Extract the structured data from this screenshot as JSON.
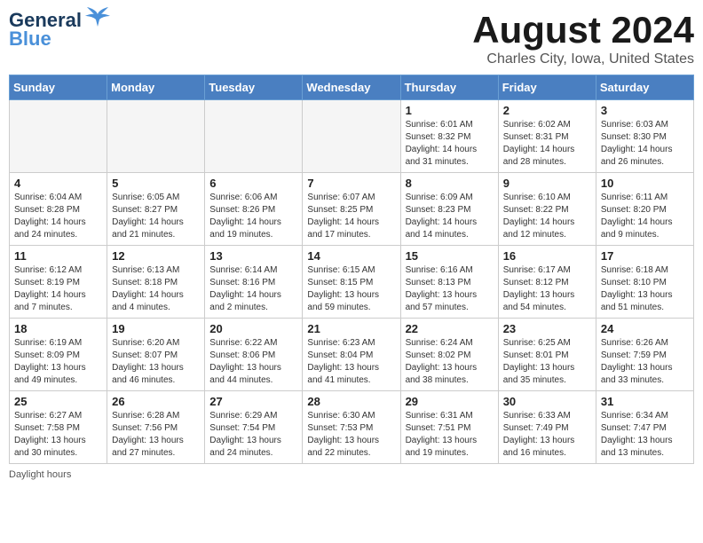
{
  "logo": {
    "line1": "General",
    "line2": "Blue"
  },
  "title": "August 2024",
  "subtitle": "Charles City, Iowa, United States",
  "days_of_week": [
    "Sunday",
    "Monday",
    "Tuesday",
    "Wednesday",
    "Thursday",
    "Friday",
    "Saturday"
  ],
  "weeks": [
    [
      {
        "day": "",
        "info": ""
      },
      {
        "day": "",
        "info": ""
      },
      {
        "day": "",
        "info": ""
      },
      {
        "day": "",
        "info": ""
      },
      {
        "day": "1",
        "info": "Sunrise: 6:01 AM\nSunset: 8:32 PM\nDaylight: 14 hours and 31 minutes."
      },
      {
        "day": "2",
        "info": "Sunrise: 6:02 AM\nSunset: 8:31 PM\nDaylight: 14 hours and 28 minutes."
      },
      {
        "day": "3",
        "info": "Sunrise: 6:03 AM\nSunset: 8:30 PM\nDaylight: 14 hours and 26 minutes."
      }
    ],
    [
      {
        "day": "4",
        "info": "Sunrise: 6:04 AM\nSunset: 8:28 PM\nDaylight: 14 hours and 24 minutes."
      },
      {
        "day": "5",
        "info": "Sunrise: 6:05 AM\nSunset: 8:27 PM\nDaylight: 14 hours and 21 minutes."
      },
      {
        "day": "6",
        "info": "Sunrise: 6:06 AM\nSunset: 8:26 PM\nDaylight: 14 hours and 19 minutes."
      },
      {
        "day": "7",
        "info": "Sunrise: 6:07 AM\nSunset: 8:25 PM\nDaylight: 14 hours and 17 minutes."
      },
      {
        "day": "8",
        "info": "Sunrise: 6:09 AM\nSunset: 8:23 PM\nDaylight: 14 hours and 14 minutes."
      },
      {
        "day": "9",
        "info": "Sunrise: 6:10 AM\nSunset: 8:22 PM\nDaylight: 14 hours and 12 minutes."
      },
      {
        "day": "10",
        "info": "Sunrise: 6:11 AM\nSunset: 8:20 PM\nDaylight: 14 hours and 9 minutes."
      }
    ],
    [
      {
        "day": "11",
        "info": "Sunrise: 6:12 AM\nSunset: 8:19 PM\nDaylight: 14 hours and 7 minutes."
      },
      {
        "day": "12",
        "info": "Sunrise: 6:13 AM\nSunset: 8:18 PM\nDaylight: 14 hours and 4 minutes."
      },
      {
        "day": "13",
        "info": "Sunrise: 6:14 AM\nSunset: 8:16 PM\nDaylight: 14 hours and 2 minutes."
      },
      {
        "day": "14",
        "info": "Sunrise: 6:15 AM\nSunset: 8:15 PM\nDaylight: 13 hours and 59 minutes."
      },
      {
        "day": "15",
        "info": "Sunrise: 6:16 AM\nSunset: 8:13 PM\nDaylight: 13 hours and 57 minutes."
      },
      {
        "day": "16",
        "info": "Sunrise: 6:17 AM\nSunset: 8:12 PM\nDaylight: 13 hours and 54 minutes."
      },
      {
        "day": "17",
        "info": "Sunrise: 6:18 AM\nSunset: 8:10 PM\nDaylight: 13 hours and 51 minutes."
      }
    ],
    [
      {
        "day": "18",
        "info": "Sunrise: 6:19 AM\nSunset: 8:09 PM\nDaylight: 13 hours and 49 minutes."
      },
      {
        "day": "19",
        "info": "Sunrise: 6:20 AM\nSunset: 8:07 PM\nDaylight: 13 hours and 46 minutes."
      },
      {
        "day": "20",
        "info": "Sunrise: 6:22 AM\nSunset: 8:06 PM\nDaylight: 13 hours and 44 minutes."
      },
      {
        "day": "21",
        "info": "Sunrise: 6:23 AM\nSunset: 8:04 PM\nDaylight: 13 hours and 41 minutes."
      },
      {
        "day": "22",
        "info": "Sunrise: 6:24 AM\nSunset: 8:02 PM\nDaylight: 13 hours and 38 minutes."
      },
      {
        "day": "23",
        "info": "Sunrise: 6:25 AM\nSunset: 8:01 PM\nDaylight: 13 hours and 35 minutes."
      },
      {
        "day": "24",
        "info": "Sunrise: 6:26 AM\nSunset: 7:59 PM\nDaylight: 13 hours and 33 minutes."
      }
    ],
    [
      {
        "day": "25",
        "info": "Sunrise: 6:27 AM\nSunset: 7:58 PM\nDaylight: 13 hours and 30 minutes."
      },
      {
        "day": "26",
        "info": "Sunrise: 6:28 AM\nSunset: 7:56 PM\nDaylight: 13 hours and 27 minutes."
      },
      {
        "day": "27",
        "info": "Sunrise: 6:29 AM\nSunset: 7:54 PM\nDaylight: 13 hours and 24 minutes."
      },
      {
        "day": "28",
        "info": "Sunrise: 6:30 AM\nSunset: 7:53 PM\nDaylight: 13 hours and 22 minutes."
      },
      {
        "day": "29",
        "info": "Sunrise: 6:31 AM\nSunset: 7:51 PM\nDaylight: 13 hours and 19 minutes."
      },
      {
        "day": "30",
        "info": "Sunrise: 6:33 AM\nSunset: 7:49 PM\nDaylight: 13 hours and 16 minutes."
      },
      {
        "day": "31",
        "info": "Sunrise: 6:34 AM\nSunset: 7:47 PM\nDaylight: 13 hours and 13 minutes."
      }
    ]
  ],
  "footer": "Daylight hours"
}
